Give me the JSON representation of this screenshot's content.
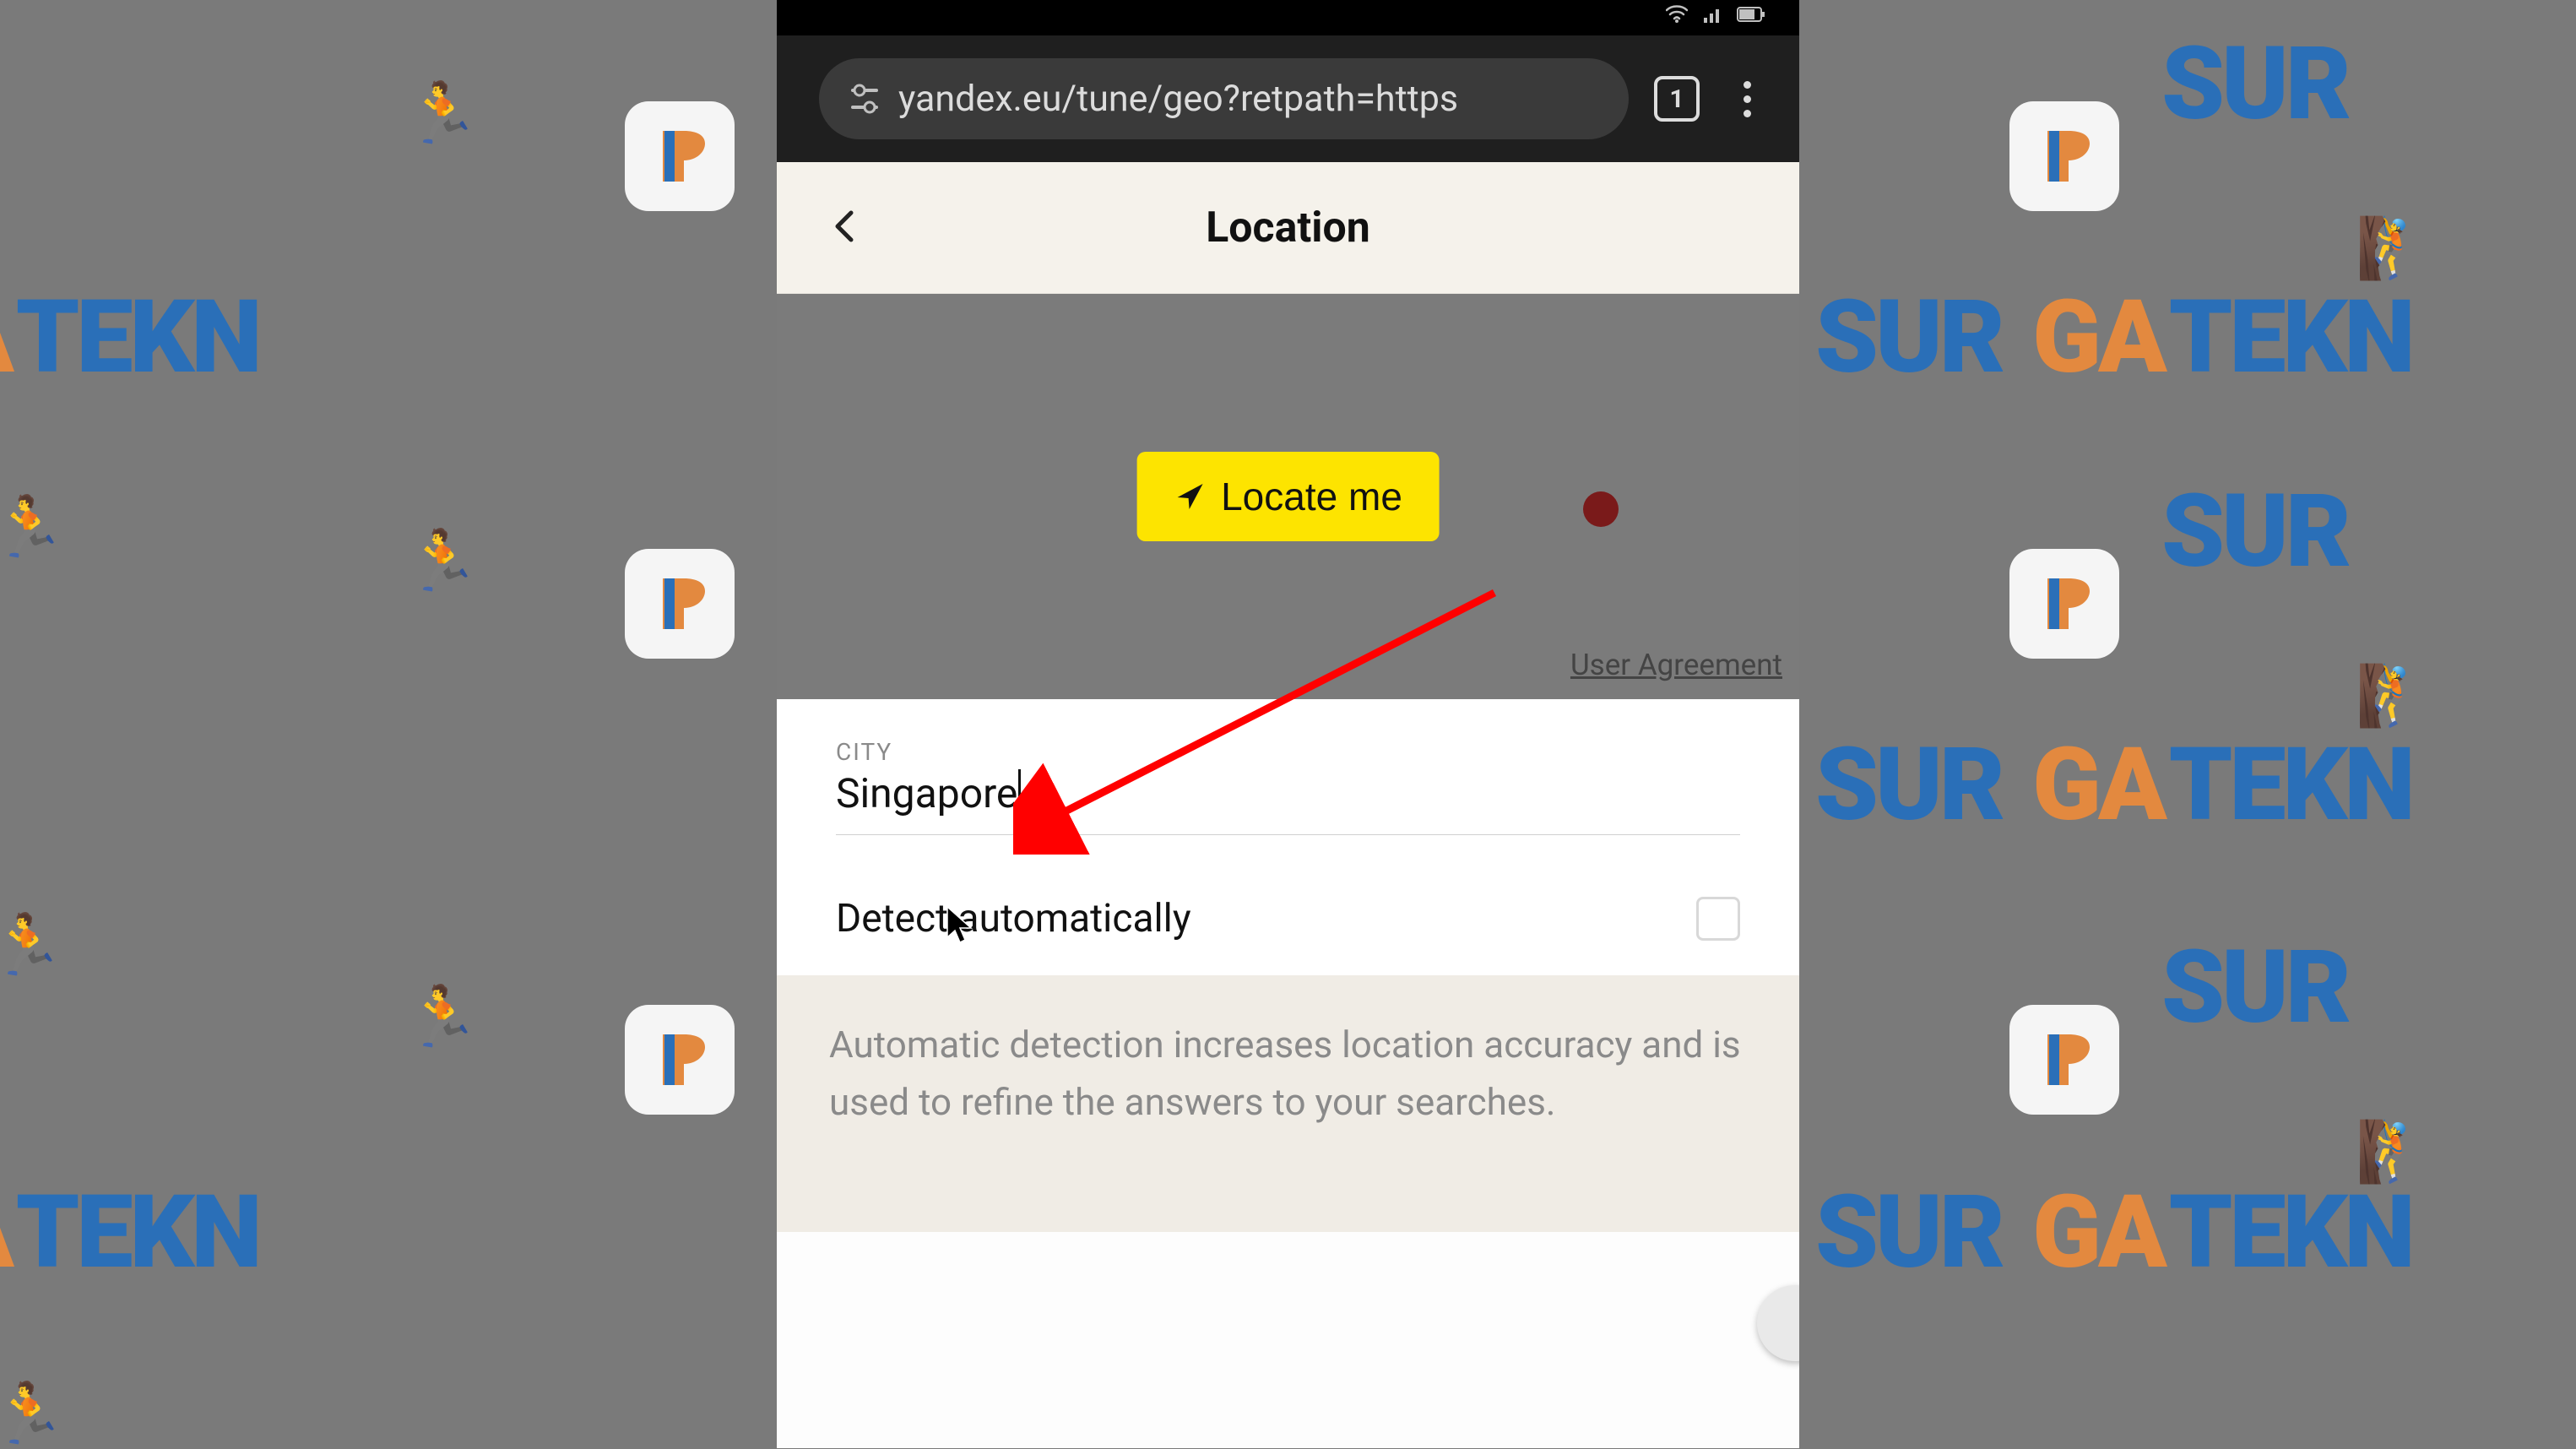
{
  "watermark": {
    "brand_part1": "SUR",
    "brand_part2": "GA",
    "brand_full": "SURGA TEKNO"
  },
  "browser": {
    "url": "yandex.eu/tune/geo?retpath=https",
    "tab_count": "1"
  },
  "page": {
    "title": "Location",
    "locate_button": "Locate me",
    "user_agreement": "User Agreement",
    "city_label": "CITY",
    "city_value": "Singapore",
    "detect_label": "Detect automatically",
    "info_text": "Automatic detection increases location accuracy and is used to refine the answers to your searches."
  }
}
